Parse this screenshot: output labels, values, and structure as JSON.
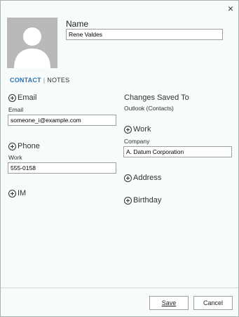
{
  "dialog": {
    "close_glyph": "×"
  },
  "name": {
    "label": "Name",
    "value": "Rene Valdes"
  },
  "tabs": [
    {
      "label": "CONTACT"
    },
    {
      "label": "NOTES"
    }
  ],
  "tab_separator": "|",
  "email": {
    "section_label": "Email",
    "field_label": "Email",
    "value": "someone_i@example.com"
  },
  "phone": {
    "section_label": "Phone",
    "field_label": "Work",
    "value": "555-0158"
  },
  "im": {
    "section_label": "IM"
  },
  "changes_saved": {
    "title": "Changes Saved To",
    "target": "Outlook (Contacts)"
  },
  "work": {
    "section_label": "Work",
    "field_label": "Company",
    "value": "A. Datum Corporation"
  },
  "address": {
    "section_label": "Address"
  },
  "birthday": {
    "section_label": "Birthday"
  },
  "buttons": {
    "save": "Save",
    "cancel": "Cancel"
  },
  "colors": {
    "accent": "#2a72b5",
    "background": "#f7fbf9",
    "avatar_bg": "#b9b9b9"
  }
}
